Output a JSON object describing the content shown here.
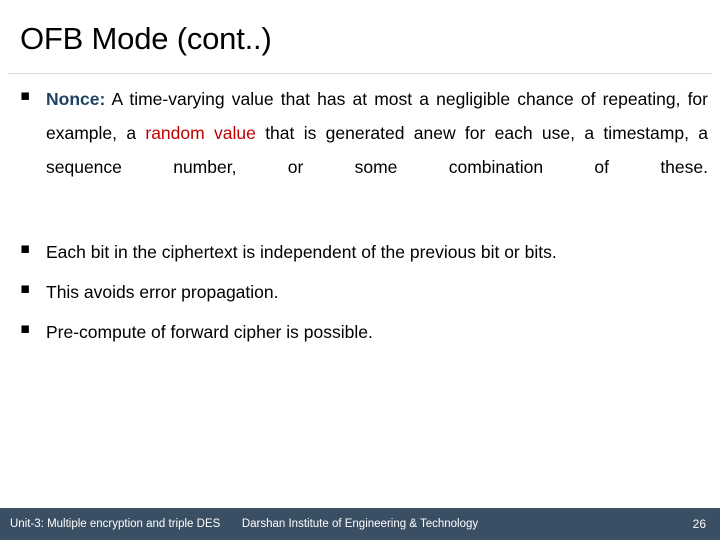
{
  "slide": {
    "title": "OFB Mode (cont..)",
    "background_color": "#ffffff",
    "bullet_glyph": "▪",
    "accent_colors": {
      "heading_blue": "#1F4363",
      "highlight_red": "#C00000",
      "footer_bar": "#3A4F63",
      "divider": "#d9d9d9"
    },
    "bullets": [
      {
        "id": "nonce",
        "lead_label": "Nonce:",
        "lead_color": "#1F4363",
        "text_part_1": " A time-varying value that has at most a negligible chance of repeating, for example, a ",
        "highlight": "random value",
        "highlight_color": "#C00000",
        "text_part_2": " that is generated anew for each use, a timestamp, a sequence number,  or some combination of these.",
        "full_text": "Nonce: A time-varying value that has at most a negligible chance of repeating, for example, a random value that is generated anew for each use, a timestamp, a sequence number,  or some combination of these."
      },
      {
        "id": "independent-bits",
        "full_text": "Each bit in the ciphertext is independent of the previous bit or bits."
      },
      {
        "id": "error-propagation",
        "full_text": "This avoids error propagation."
      },
      {
        "id": "pre-compute",
        "full_text": "Pre-compute of forward cipher is possible."
      }
    ]
  },
  "footer": {
    "left": "Unit-3: Multiple encryption and triple DES",
    "center": "Darshan Institute of Engineering & Technology",
    "page_number": "26"
  }
}
